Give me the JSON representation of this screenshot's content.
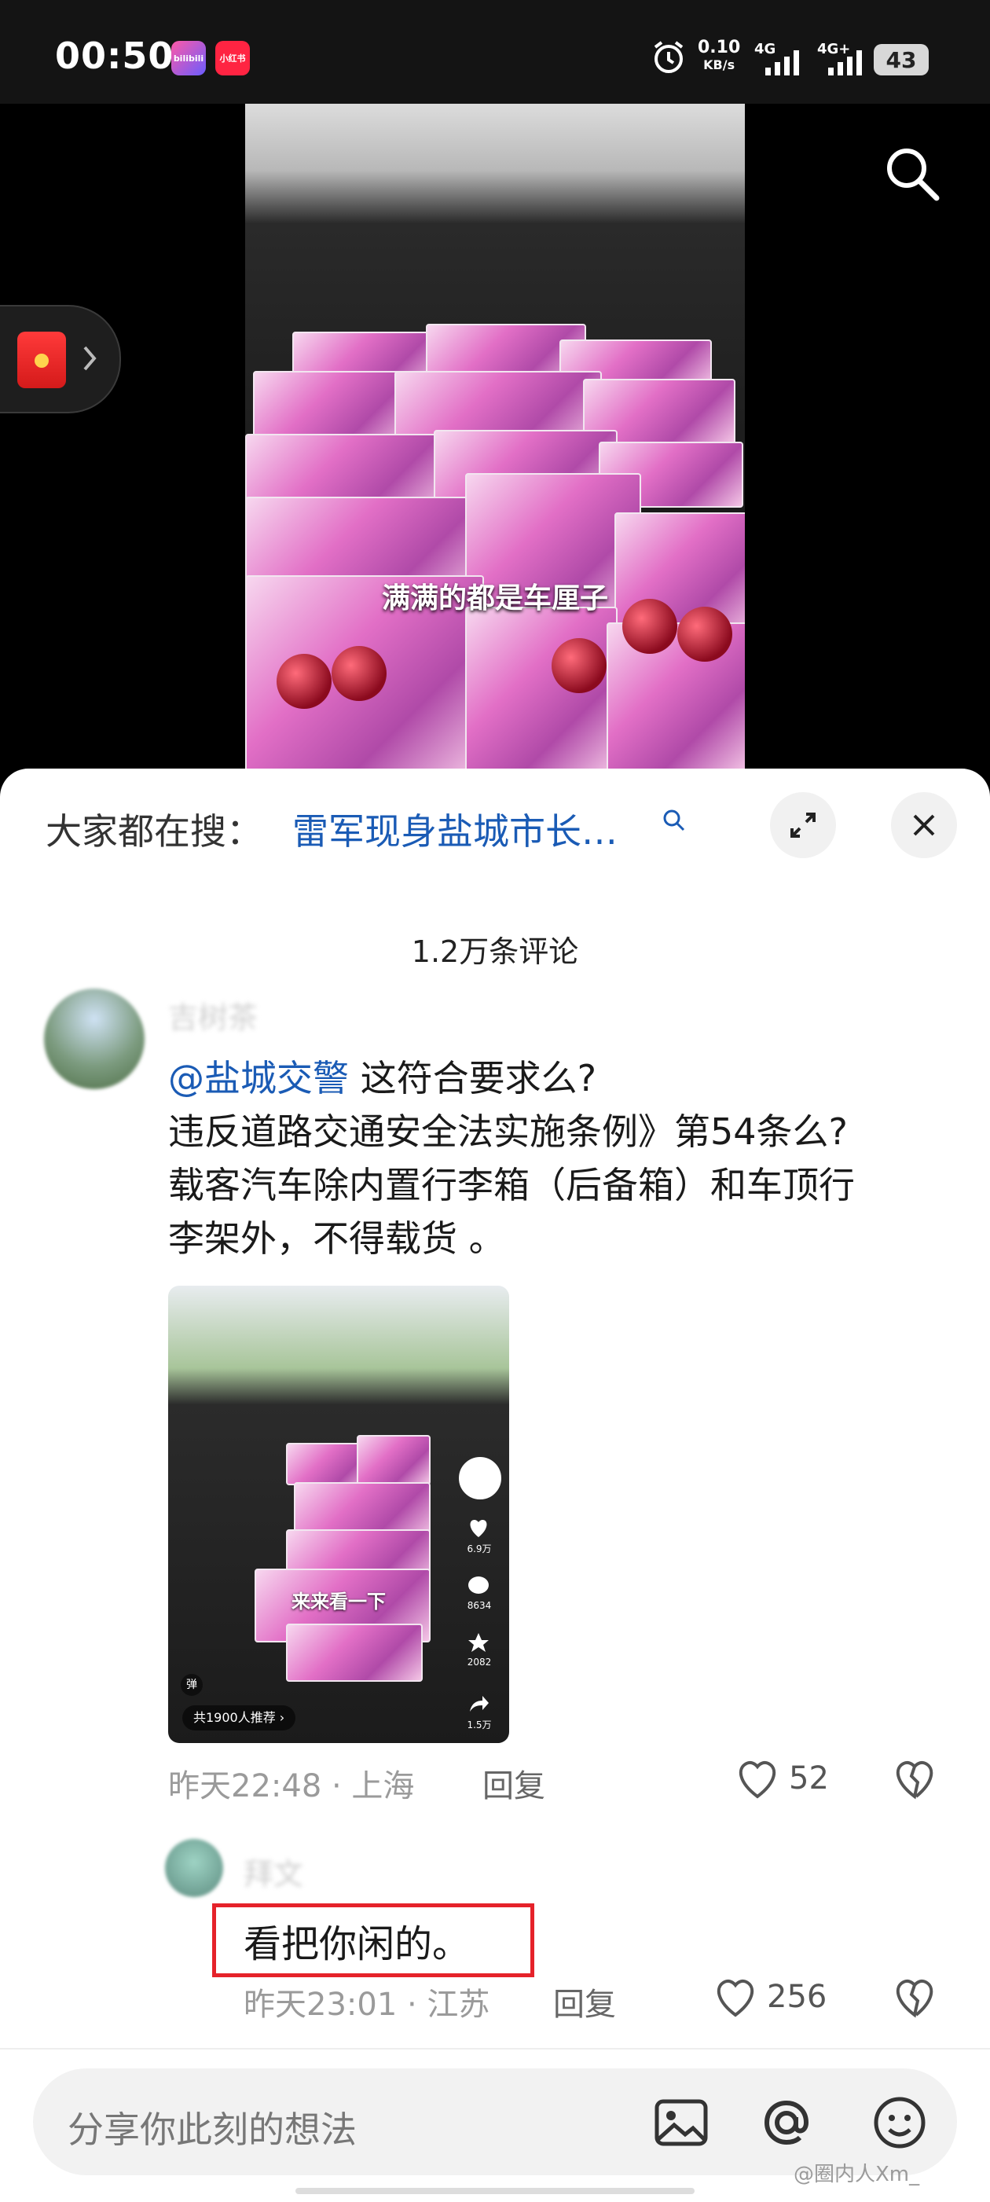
{
  "status_bar": {
    "time": "00:50",
    "app1_label": "bilibili",
    "app2_label": "小红书",
    "net_speed_value": "0.10",
    "net_speed_unit": "KB/s",
    "signal1": "4G",
    "signal2": "4G+",
    "battery": "43"
  },
  "video": {
    "subtitle": "满满的都是车厘子"
  },
  "panel": {
    "search_hint_label": "大家都在搜：",
    "search_hint_link": "雷军现身盐城市长…",
    "comment_count": "1.2万条评论"
  },
  "comment1": {
    "username": "吉树茶",
    "mention": "@盐城交警",
    "line1_rest": " 这符合要求么?",
    "line2": "违反道路交通安全法实施条例》第54条么?",
    "line3": "载客汽车除内置行李箱（后备箱）和车顶行",
    "line4": "李架外，不得载货 。",
    "thumb": {
      "caption": "来来看一下",
      "likes": "6.9万",
      "comments": "8634",
      "favorites": "2082",
      "shares": "1.5万",
      "danmaku": "弹",
      "recommend": "共1900人推荐 ›"
    },
    "meta": "昨天22:48 · 上海",
    "reply": "回复",
    "like_count": "52"
  },
  "comment2": {
    "username": "拜文",
    "text": "看把你闲的。",
    "meta": "昨天23:01 · 江苏",
    "reply": "回复",
    "like_count": "256"
  },
  "input": {
    "placeholder": "分享你此刻的想法"
  },
  "watermark": "@圈内人Xm_"
}
